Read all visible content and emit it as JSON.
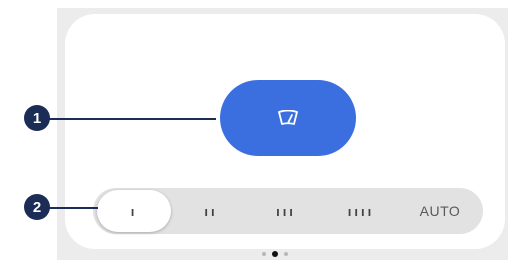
{
  "callouts": [
    {
      "label": "1"
    },
    {
      "label": "2"
    }
  ],
  "wiper_button": {
    "icon": "windshield-wiper-icon",
    "color": "#3b6fe0"
  },
  "speed_options": [
    {
      "label": "ı",
      "selected": true
    },
    {
      "label": "ıı",
      "selected": false
    },
    {
      "label": "ııı",
      "selected": false
    },
    {
      "label": "ıııı",
      "selected": false
    },
    {
      "label": "AUTO",
      "selected": false
    }
  ],
  "pagination": {
    "pages": 3,
    "current": 2
  },
  "colors": {
    "accent": "#3b6fe0",
    "callout": "#1b2d57",
    "track": "#e2e2e2"
  }
}
